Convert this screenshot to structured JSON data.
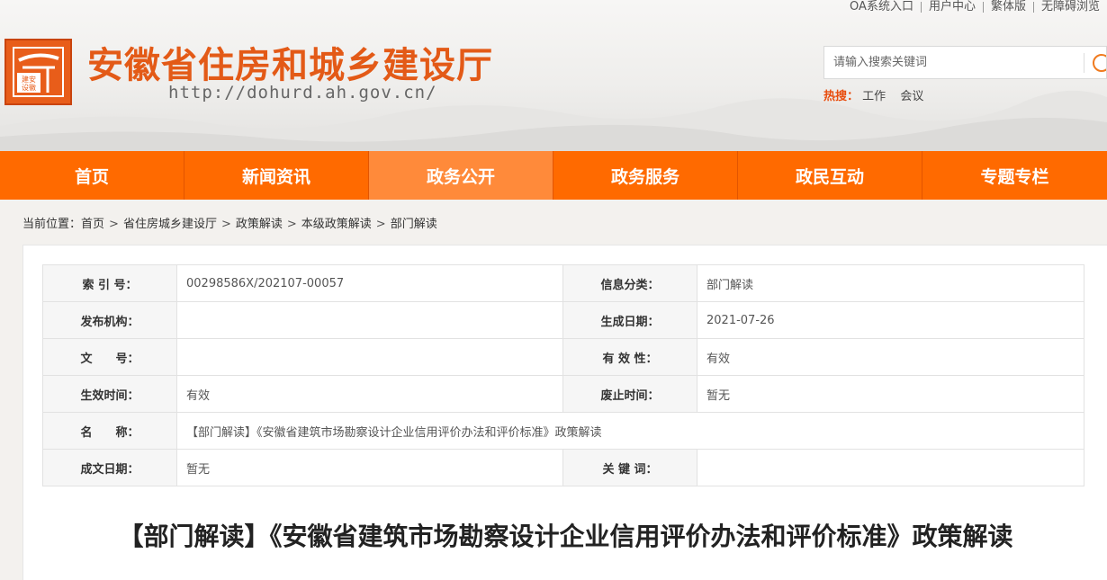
{
  "top_links": [
    "OA系统入口",
    "用户中心",
    "繁体版",
    "无障碍浏览"
  ],
  "header": {
    "title": "安徽省住房和城乡建设厅",
    "url": "http://dohurd.ah.gov.cn/",
    "logo_text": "建设安徽"
  },
  "search": {
    "placeholder": "请输入搜索关键词",
    "hot_label": "热搜：",
    "hot_words": [
      "工作",
      "会议"
    ]
  },
  "nav": {
    "items": [
      "首页",
      "新闻资讯",
      "政务公开",
      "政务服务",
      "政民互动",
      "专题专栏"
    ],
    "active_index": 2
  },
  "breadcrumb": {
    "prefix": "当前位置：",
    "items": [
      "首页",
      "省住房城乡建设厅",
      "政策解读",
      "本级政策解读",
      "部门解读"
    ],
    "separator": ">"
  },
  "meta": {
    "index_no_label": "索 引 号：",
    "index_no": "00298586X/202107-00057",
    "category_label": "信息分类：",
    "category": "部门解读",
    "issuer_label": "发布机构：",
    "issuer": "",
    "gen_date_label": "生成日期：",
    "gen_date": "2021-07-26",
    "doc_no_label": "文　　号：",
    "doc_no": "",
    "validity_label": "有 效 性：",
    "validity": "有效",
    "effective_label": "生效时间：",
    "effective": "有效",
    "abolish_label": "废止时间：",
    "abolish": "暂无",
    "name_label": "名　　称：",
    "name": "【部门解读】《安徽省建筑市场勘察设计企业信用评价办法和评价标准》政策解读",
    "created_label": "成文日期：",
    "created": "暂无",
    "keywords_label": "关 键 词：",
    "keywords": ""
  },
  "article": {
    "title": "【部门解读】《安徽省建筑市场勘察设计企业信用评价办法和评价标准》政策解读"
  },
  "colors": {
    "brand_orange": "#ff6a00",
    "title_orange": "#e35a17",
    "nav_active": "#ff8a3a"
  }
}
